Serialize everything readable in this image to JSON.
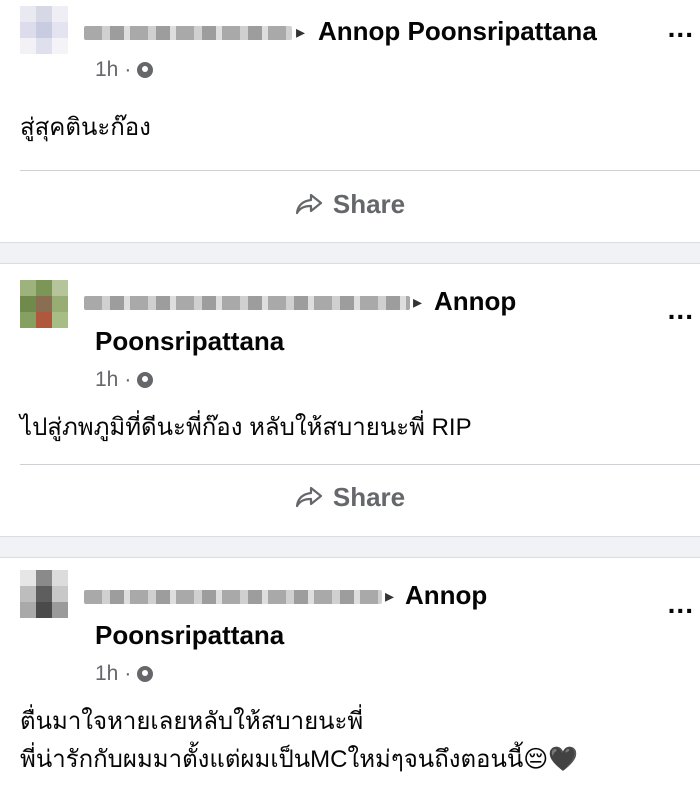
{
  "posts": [
    {
      "target_name": "Annop Poonsripattana",
      "time": "1h",
      "separator": "·",
      "text": "สู่สุคตินะก๊อง",
      "share_label": "Share",
      "more": "..."
    },
    {
      "target_name_line1": "Annop",
      "target_name_line2": "Poonsripattana",
      "time": "1h",
      "separator": "·",
      "text": "ไปสู่ภพภูมิที่ดีนะพี่ก๊อง หลับให้สบายนะพี่  RIP",
      "share_label": "Share",
      "more": "..."
    },
    {
      "target_name_line1": "Annop",
      "target_name_line2": "Poonsripattana",
      "time": "1h",
      "separator": "·",
      "text_line1": "ตื่นมาใจหายเลยหลับให้สบายนะพี่",
      "text_line2": "พี่น่ารักกับผมมาตั้งแต่ผมเป็นMCใหม่ๆจนถึงตอนนี้😔🖤",
      "more": "..."
    }
  ],
  "colors": {
    "muted": "#65676b",
    "text": "#050505",
    "separator_bg": "#f0f2f5"
  },
  "icons": {
    "share": "share-arrow-icon",
    "audience": "globe-icon",
    "arrow": "triangle-right-icon"
  }
}
